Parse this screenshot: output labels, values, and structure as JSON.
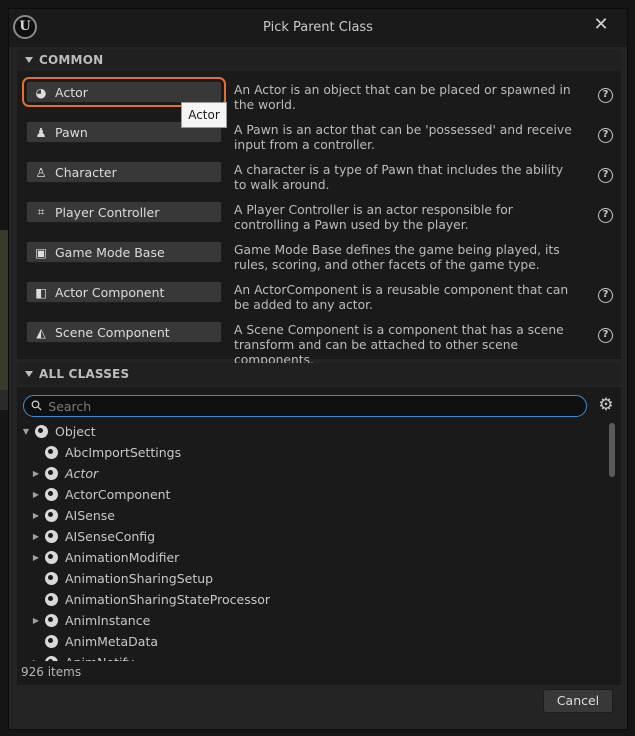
{
  "dialog": {
    "title": "Pick Parent Class",
    "close_glyph": "✕"
  },
  "common": {
    "header": "COMMON",
    "items": [
      {
        "label": "Actor",
        "icon": "actor-icon",
        "glyph": "◕",
        "desc": "An Actor is an object that can be placed or spawned in the world.",
        "selected": true
      },
      {
        "label": "Pawn",
        "icon": "pawn-icon",
        "glyph": "♟",
        "desc": "A Pawn is an actor that can be 'possessed' and receive input from a controller."
      },
      {
        "label": "Character",
        "icon": "character-icon",
        "glyph": "♙",
        "desc": "A character is a type of Pawn that includes the ability to walk around."
      },
      {
        "label": "Player Controller",
        "icon": "gamepad-icon",
        "glyph": "⌗",
        "desc": "A Player Controller is an actor responsible for controlling a Pawn used by the player."
      },
      {
        "label": "Game Mode Base",
        "icon": "game-mode-icon",
        "glyph": "▣",
        "desc": "Game Mode Base defines the game being played, its rules, scoring, and other facets of the game type."
      },
      {
        "label": "Actor Component",
        "icon": "actor-component-icon",
        "glyph": "◧",
        "desc": "An ActorComponent is a reusable component that can be added to any actor."
      },
      {
        "label": "Scene Component",
        "icon": "scene-component-icon",
        "glyph": "◭",
        "desc": "A Scene Component is a component that has a scene transform and can be attached to other scene components."
      }
    ],
    "help_glyph": "?"
  },
  "tooltip": "Actor",
  "all_classes": {
    "header": "ALL CLASSES",
    "search_placeholder": "Search",
    "search_value": "",
    "search_glyph": "⚲",
    "settings_glyph": "⚙",
    "tree": [
      {
        "label": "Object",
        "depth": 0,
        "expanded": true,
        "icon": "object-icon"
      },
      {
        "label": "AbcImportSettings",
        "depth": 1,
        "icon": "object-icon"
      },
      {
        "label": "Actor",
        "depth": 1,
        "collapsed": true,
        "italic": true,
        "icon": "actor-icon"
      },
      {
        "label": "ActorComponent",
        "depth": 1,
        "collapsed": true,
        "icon": "actor-component-icon"
      },
      {
        "label": "AISense",
        "depth": 1,
        "collapsed": true,
        "icon": "object-icon"
      },
      {
        "label": "AISenseConfig",
        "depth": 1,
        "collapsed": true,
        "icon": "object-icon"
      },
      {
        "label": "AnimationModifier",
        "depth": 1,
        "collapsed": true,
        "icon": "animation-modifier-icon"
      },
      {
        "label": "AnimationSharingSetup",
        "depth": 1,
        "icon": "animation-sharing-icon"
      },
      {
        "label": "AnimationSharingStateProcessor",
        "depth": 1,
        "icon": "object-icon"
      },
      {
        "label": "AnimInstance",
        "depth": 1,
        "collapsed": true,
        "icon": "anim-instance-icon"
      },
      {
        "label": "AnimMetaData",
        "depth": 1,
        "icon": "object-icon"
      },
      {
        "label": "AnimNotify",
        "depth": 1,
        "collapsed": true,
        "icon": "object-icon"
      }
    ],
    "count": "926 items"
  },
  "footer": {
    "cancel_label": "Cancel"
  }
}
